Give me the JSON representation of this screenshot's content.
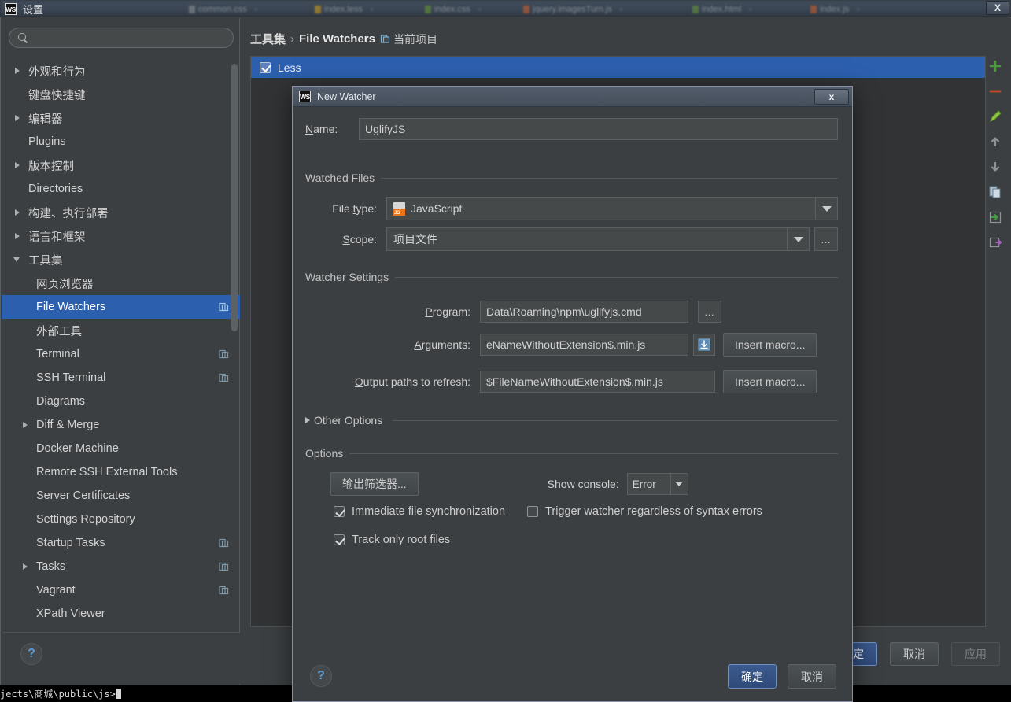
{
  "window": {
    "app_badge": "WS",
    "title": "设置",
    "close_label": "X"
  },
  "editor_tabs": [
    {
      "label": "common.css",
      "color": "#6a9a3a"
    },
    {
      "label": "index.less",
      "color": "#d8a21c"
    },
    {
      "label": "index.css",
      "color": "#6a9a3a"
    },
    {
      "label": "jquery.imagesTurn.js",
      "color": "#d4602a"
    },
    {
      "label": "index.html",
      "color": "#6a9a3a"
    },
    {
      "label": "index.js",
      "color": "#d4602a"
    }
  ],
  "sidebar": {
    "search": {
      "value": "",
      "placeholder": ""
    },
    "items": [
      {
        "label": "外观和行为",
        "depth": 1,
        "arrow": "closed",
        "badge": false
      },
      {
        "label": "键盘快捷键",
        "depth": 1,
        "arrow": "none",
        "badge": false
      },
      {
        "label": "编辑器",
        "depth": 1,
        "arrow": "closed",
        "badge": false
      },
      {
        "label": "Plugins",
        "depth": 1,
        "arrow": "none",
        "badge": false
      },
      {
        "label": "版本控制",
        "depth": 1,
        "arrow": "closed",
        "badge": false
      },
      {
        "label": "Directories",
        "depth": 1,
        "arrow": "none",
        "badge": false
      },
      {
        "label": "构建、执行部署",
        "depth": 1,
        "arrow": "closed",
        "badge": false
      },
      {
        "label": "语言和框架",
        "depth": 1,
        "arrow": "closed",
        "badge": false
      },
      {
        "label": "工具集",
        "depth": 1,
        "arrow": "open",
        "badge": false
      },
      {
        "label": "网页浏览器",
        "depth": 2,
        "arrow": "none",
        "badge": false
      },
      {
        "label": "File Watchers",
        "depth": 2,
        "arrow": "none",
        "badge": true,
        "selected": true
      },
      {
        "label": "外部工具",
        "depth": 2,
        "arrow": "none",
        "badge": false
      },
      {
        "label": "Terminal",
        "depth": 2,
        "arrow": "none",
        "badge": true
      },
      {
        "label": "SSH Terminal",
        "depth": 2,
        "arrow": "none",
        "badge": true
      },
      {
        "label": "Diagrams",
        "depth": 2,
        "arrow": "none",
        "badge": false
      },
      {
        "label": "Diff & Merge",
        "depth": 2,
        "arrow": "closed",
        "badge": false
      },
      {
        "label": "Docker Machine",
        "depth": 2,
        "arrow": "none",
        "badge": false
      },
      {
        "label": "Remote SSH External Tools",
        "depth": 2,
        "arrow": "none",
        "badge": false
      },
      {
        "label": "Server Certificates",
        "depth": 2,
        "arrow": "none",
        "badge": false
      },
      {
        "label": "Settings Repository",
        "depth": 2,
        "arrow": "none",
        "badge": false
      },
      {
        "label": "Startup Tasks",
        "depth": 2,
        "arrow": "none",
        "badge": true
      },
      {
        "label": "Tasks",
        "depth": 2,
        "arrow": "closed",
        "badge": true
      },
      {
        "label": "Vagrant",
        "depth": 2,
        "arrow": "none",
        "badge": true
      },
      {
        "label": "XPath Viewer",
        "depth": 2,
        "arrow": "none",
        "badge": false
      }
    ],
    "help_label": "?"
  },
  "content": {
    "breadcrumb": {
      "root": "工具集",
      "sep": "›",
      "current": "File Watchers",
      "project_scope": "当前项目"
    },
    "watchers": [
      {
        "name": "Less",
        "checked": true,
        "selected": true
      }
    ],
    "toolbar": [
      {
        "name": "add-watcher-button",
        "glyph": "+"
      },
      {
        "name": "remove-watcher-button",
        "glyph": "−"
      },
      {
        "name": "edit-watcher-button",
        "glyph": "✎"
      },
      {
        "name": "move-up-button",
        "glyph": "↑"
      },
      {
        "name": "move-down-button",
        "glyph": "↓"
      },
      {
        "name": "copy-watcher-button",
        "glyph": "⧉"
      },
      {
        "name": "import-button",
        "glyph": "⇥"
      },
      {
        "name": "export-button",
        "glyph": "⇤"
      }
    ],
    "footer_buttons": {
      "ok": "确定",
      "cancel": "取消",
      "apply": "应用"
    }
  },
  "modal": {
    "badge": "WS",
    "title": "New Watcher",
    "close_label": "x",
    "name": {
      "label": "Name:",
      "value": "UglifyJS"
    },
    "watched_files": {
      "title": "Watched Files",
      "file_type": {
        "label": "File type:",
        "value": "JavaScript"
      },
      "scope": {
        "label": "Scope:",
        "value": "项目文件",
        "ellipsis": "…"
      }
    },
    "watcher_settings": {
      "title": "Watcher Settings",
      "program": {
        "label": "Program:",
        "value": "Data\\Roaming\\npm\\uglifyjs.cmd",
        "ellipsis": "…"
      },
      "arguments": {
        "label": "Arguments:",
        "value": "eNameWithoutExtension$.min.js",
        "insert_macro": "Insert macro..."
      },
      "output_paths": {
        "label": "Output paths to refresh:",
        "value": "$FileNameWithoutExtension$.min.js",
        "insert_macro": "Insert macro..."
      },
      "other_options": "Other Options"
    },
    "options": {
      "title": "Options",
      "output_filters_button": "输出筛选器...",
      "show_console": {
        "label": "Show console:",
        "value": "Error"
      },
      "immediate_sync": {
        "label": "Immediate file synchronization",
        "checked": true
      },
      "trigger_regardless": {
        "label": "Trigger watcher regardless of syntax errors",
        "checked": false
      },
      "track_root_files": {
        "label": "Track only root files",
        "checked": true
      }
    },
    "help_label": "?",
    "buttons": {
      "ok": "确定",
      "cancel": "取消"
    }
  },
  "console": {
    "text": "jects\\商城\\public\\js>"
  },
  "colors": {
    "accent": "#2d5faf",
    "panel": "#3c3f41",
    "field": "#45494a",
    "text": "#cfcfcf"
  }
}
